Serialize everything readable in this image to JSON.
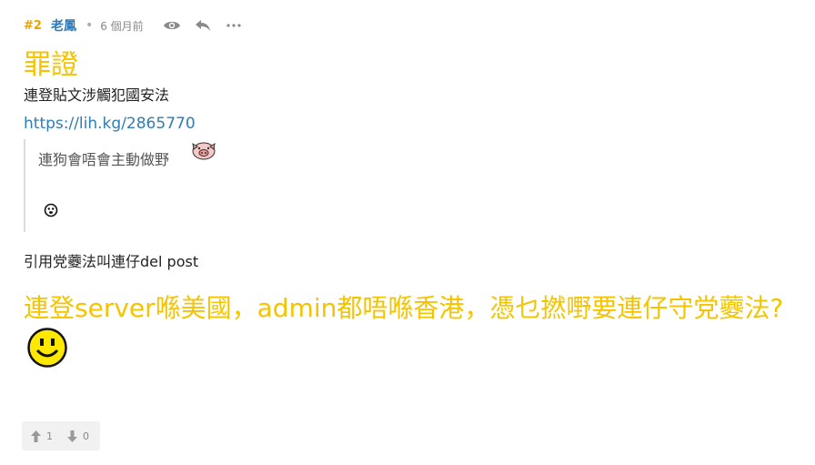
{
  "post": {
    "floor": "#2",
    "username": "老鳳",
    "separator": "•",
    "time": "6 個月前",
    "title": "罪證",
    "line1": "連登貼文涉觸犯國安法",
    "link": "https://lih.kg/2865770",
    "quote_text": "連狗會唔會主動做野",
    "line3": "引用党虁法叫連仔del post",
    "big_text": "連登server喺美國，admin都唔喺香港，憑乜撚嘢要連仔守党虁法?"
  },
  "header_icons": [
    "eye-icon",
    "reply-icon",
    "more-icon"
  ],
  "votes": {
    "up": "1",
    "down": "0"
  },
  "colors": {
    "title": "#f5c400",
    "floor": "#e8a200",
    "user": "#2e7ab8",
    "link": "#2f7db3"
  }
}
